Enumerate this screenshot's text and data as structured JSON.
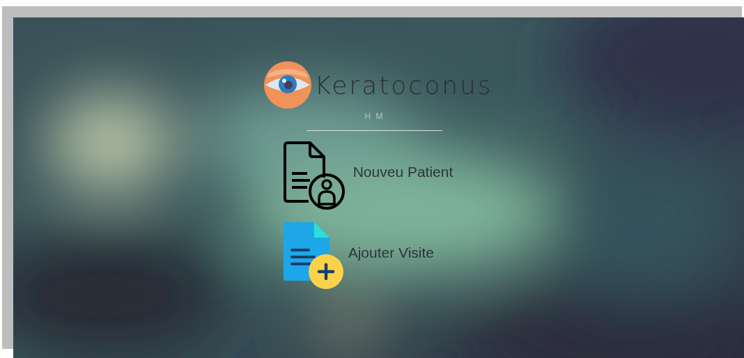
{
  "header": {
    "title": "Keratoconus",
    "subtitle": "H M"
  },
  "menu": [
    {
      "label": "Nouveu Patient"
    },
    {
      "label": "Ajouter Visite"
    }
  ]
}
